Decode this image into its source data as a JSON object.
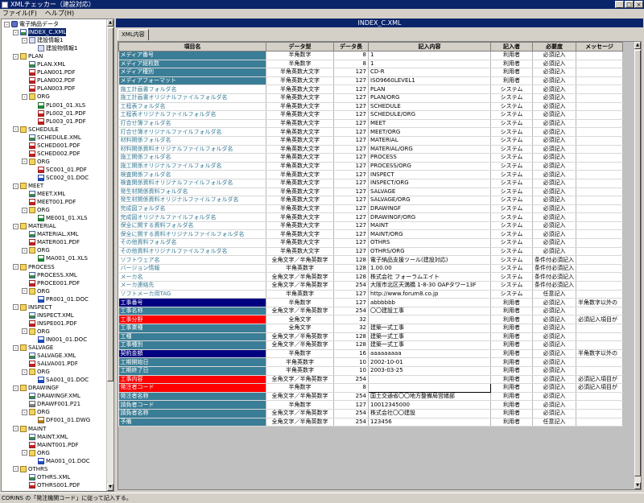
{
  "window": {
    "title": "XMLチェッカー（建設対応）",
    "buttons": [
      "_",
      "□",
      "×"
    ]
  },
  "menu": [
    {
      "label": "ファイル(F)"
    },
    {
      "label": "ヘルプ(H)"
    }
  ],
  "tree": {
    "items": [
      {
        "label": "電子納品データ",
        "level": 0,
        "icon": "db",
        "box": "-"
      },
      {
        "label": "INDEX_C.XML",
        "level": 1,
        "icon": "xml",
        "box": "-",
        "selected": true
      },
      {
        "label": "建設情報1",
        "level": 2,
        "icon": "node",
        "box": "-"
      },
      {
        "label": "建設物情報1",
        "level": 3,
        "icon": "node",
        "box": ""
      },
      {
        "label": "PLAN",
        "level": 1,
        "icon": "folder",
        "box": "-"
      },
      {
        "label": "PLAN.XML",
        "level": 2,
        "icon": "xml",
        "box": ""
      },
      {
        "label": "PLAN001.PDF",
        "level": 2,
        "icon": "pdf",
        "box": ""
      },
      {
        "label": "PLAN002.PDF",
        "level": 2,
        "icon": "pdf",
        "box": ""
      },
      {
        "label": "PLAN003.PDF",
        "level": 2,
        "icon": "pdf",
        "box": ""
      },
      {
        "label": "ORG",
        "level": 2,
        "icon": "folder",
        "box": "-"
      },
      {
        "label": "PL001_01.XLS",
        "level": 3,
        "icon": "xls",
        "box": ""
      },
      {
        "label": "PL002_01.PDF",
        "level": 3,
        "icon": "pdf",
        "box": ""
      },
      {
        "label": "PL003_01.PDF",
        "level": 3,
        "icon": "pdf",
        "box": ""
      },
      {
        "label": "SCHEDULE",
        "level": 1,
        "icon": "folder",
        "box": "-"
      },
      {
        "label": "SCHEDULE.XML",
        "level": 2,
        "icon": "xml",
        "box": ""
      },
      {
        "label": "SCHED001.PDF",
        "level": 2,
        "icon": "pdf",
        "box": ""
      },
      {
        "label": "SCHED002.PDF",
        "level": 2,
        "icon": "pdf",
        "box": ""
      },
      {
        "label": "ORG",
        "level": 2,
        "icon": "folder",
        "box": "-"
      },
      {
        "label": "SC001_01.PDF",
        "level": 3,
        "icon": "pdf",
        "box": ""
      },
      {
        "label": "SC002_01.DOC",
        "level": 3,
        "icon": "doc",
        "box": ""
      },
      {
        "label": "MEET",
        "level": 1,
        "icon": "folder",
        "box": "-"
      },
      {
        "label": "MEET.XML",
        "level": 2,
        "icon": "xml",
        "box": ""
      },
      {
        "label": "MEET001.PDF",
        "level": 2,
        "icon": "pdf",
        "box": ""
      },
      {
        "label": "ORG",
        "level": 2,
        "icon": "folder",
        "box": "-"
      },
      {
        "label": "ME001_01.XLS",
        "level": 3,
        "icon": "xls",
        "box": ""
      },
      {
        "label": "MATERIAL",
        "level": 1,
        "icon": "folder",
        "box": "-"
      },
      {
        "label": "MATERIAL.XML",
        "level": 2,
        "icon": "xml",
        "box": ""
      },
      {
        "label": "MATER001.PDF",
        "level": 2,
        "icon": "pdf",
        "box": ""
      },
      {
        "label": "ORG",
        "level": 2,
        "icon": "folder",
        "box": "-"
      },
      {
        "label": "MA001_01.XLS",
        "level": 3,
        "icon": "xls",
        "box": ""
      },
      {
        "label": "PROCESS",
        "level": 1,
        "icon": "folder",
        "box": "-"
      },
      {
        "label": "PROCESS.XML",
        "level": 2,
        "icon": "xml",
        "box": ""
      },
      {
        "label": "PROCE001.PDF",
        "level": 2,
        "icon": "pdf",
        "box": ""
      },
      {
        "label": "ORG",
        "level": 2,
        "icon": "folder",
        "box": "-"
      },
      {
        "label": "PR001_01.DOC",
        "level": 3,
        "icon": "doc",
        "box": ""
      },
      {
        "label": "INSPECT",
        "level": 1,
        "icon": "folder",
        "box": "-"
      },
      {
        "label": "INSPECT.XML",
        "level": 2,
        "icon": "xml",
        "box": ""
      },
      {
        "label": "INSPE001.PDF",
        "level": 2,
        "icon": "pdf",
        "box": ""
      },
      {
        "label": "ORG",
        "level": 2,
        "icon": "folder",
        "box": "-"
      },
      {
        "label": "IN001_01.DOC",
        "level": 3,
        "icon": "doc",
        "box": ""
      },
      {
        "label": "SALVAGE",
        "level": 1,
        "icon": "folder",
        "box": "-"
      },
      {
        "label": "SALVAGE.XML",
        "level": 2,
        "icon": "xml",
        "box": ""
      },
      {
        "label": "SALVA001.PDF",
        "level": 2,
        "icon": "pdf",
        "box": ""
      },
      {
        "label": "ORG",
        "level": 2,
        "icon": "folder",
        "box": "-"
      },
      {
        "label": "SA001_01.DOC",
        "level": 3,
        "icon": "doc",
        "box": ""
      },
      {
        "label": "DRAWINGF",
        "level": 1,
        "icon": "folder",
        "box": "-"
      },
      {
        "label": "DRAWINGF.XML",
        "level": 2,
        "icon": "xml",
        "box": ""
      },
      {
        "label": "DRAWF001.P21",
        "level": 2,
        "icon": "p21",
        "box": ""
      },
      {
        "label": "ORG",
        "level": 2,
        "icon": "folder",
        "box": "-"
      },
      {
        "label": "DF001_01.DWG",
        "level": 3,
        "icon": "dwg",
        "box": ""
      },
      {
        "label": "MAINT",
        "level": 1,
        "icon": "folder",
        "box": "-"
      },
      {
        "label": "MAINT.XML",
        "level": 2,
        "icon": "xml",
        "box": ""
      },
      {
        "label": "MAINT001.PDF",
        "level": 2,
        "icon": "pdf",
        "box": ""
      },
      {
        "label": "ORG",
        "level": 2,
        "icon": "folder",
        "box": "-"
      },
      {
        "label": "MA001_01.DOC",
        "level": 3,
        "icon": "doc",
        "box": ""
      },
      {
        "label": "OTHRS",
        "level": 1,
        "icon": "folder",
        "box": "-"
      },
      {
        "label": "OTHRS.XML",
        "level": 2,
        "icon": "xml",
        "box": ""
      },
      {
        "label": "OTHRS001.PDF",
        "level": 2,
        "icon": "pdf",
        "box": ""
      }
    ]
  },
  "header": {
    "title": "INDEX_C.XML"
  },
  "tab": {
    "label": "XML内容"
  },
  "grid": {
    "columns": [
      "項目名",
      "データ型",
      "データ長",
      "記入内容",
      "記入者",
      "必要度",
      "メッセージ"
    ],
    "styles": {
      "teal": {
        "bg": "#3a7d96",
        "fg": "#ffffff"
      },
      "link": {
        "bg": "#ffffff",
        "fg": "#3a7d96"
      },
      "navy": {
        "bg": "#000080",
        "fg": "#ffffff"
      },
      "red": {
        "bg": "#ff0000",
        "fg": "#ffffff"
      }
    },
    "rows": [
      [
        "メディア番号",
        "半角数字",
        "8",
        "1",
        "利用者",
        "必須記入",
        "",
        "teal"
      ],
      [
        "メディア総枚数",
        "半角数字",
        "8",
        "1",
        "利用者",
        "必須記入",
        "",
        "teal"
      ],
      [
        "メディア種別",
        "半角英数大文字",
        "127",
        "CD-R",
        "利用者",
        "必須記入",
        "",
        "teal"
      ],
      [
        "メディアフォーマット",
        "半角英数大文字",
        "127",
        "ISO9660LEVEL1",
        "利用者",
        "必須記入",
        "",
        "teal"
      ],
      [
        "施工計画書フォルダ名",
        "半角英数大文字",
        "127",
        "PLAN",
        "システム",
        "必須記入",
        "",
        "link"
      ],
      [
        "施工計画書オリジナルファイルフォルダ名",
        "半角英数大文字",
        "127",
        "PLAN/ORG",
        "システム",
        "必須記入",
        "",
        "link"
      ],
      [
        "工程表フォルダ名",
        "半角英数大文字",
        "127",
        "SCHEDULE",
        "システム",
        "必須記入",
        "",
        "link"
      ],
      [
        "工程表オリジナルファイルフォルダ名",
        "半角英数大文字",
        "127",
        "SCHEDULE/ORG",
        "システム",
        "必須記入",
        "",
        "link"
      ],
      [
        "打合せ簿フォルダ名",
        "半角英数大文字",
        "127",
        "MEET",
        "システム",
        "必須記入",
        "",
        "link"
      ],
      [
        "打合せ簿オリジナルファイルフォルダ名",
        "半角英数大文字",
        "127",
        "MEET/ORG",
        "システム",
        "必須記入",
        "",
        "link"
      ],
      [
        "材料関係フォルダ名",
        "半角英数大文字",
        "127",
        "MATERIAL",
        "システム",
        "必須記入",
        "",
        "link"
      ],
      [
        "材料関係資料オリジナルファイルフォルダ名",
        "半角英数大文字",
        "127",
        "MATERIAL/ORG",
        "システム",
        "必須記入",
        "",
        "link"
      ],
      [
        "施工関係フォルダ名",
        "半角英数大文字",
        "127",
        "PROCESS",
        "システム",
        "必須記入",
        "",
        "link"
      ],
      [
        "施工関係オリジナルファイルフォルダ名",
        "半角英数大文字",
        "127",
        "PROCESS/ORG",
        "システム",
        "必須記入",
        "",
        "link"
      ],
      [
        "検査関係フォルダ名",
        "半角英数大文字",
        "127",
        "INSPECT",
        "システム",
        "必須記入",
        "",
        "link"
      ],
      [
        "検査関係資料オリジナルファイルフォルダ名",
        "半角英数大文字",
        "127",
        "INSPECT/ORG",
        "システム",
        "必須記入",
        "",
        "link"
      ],
      [
        "発生材関係資料フォルダ名",
        "半角英数大文字",
        "127",
        "SALVAGE",
        "システム",
        "必須記入",
        "",
        "link"
      ],
      [
        "発生材関係資料オリジナルファイルフォルダ名",
        "半角英数大文字",
        "127",
        "SALVAGE/ORG",
        "システム",
        "必須記入",
        "",
        "link"
      ],
      [
        "完成図フォルダ名",
        "半角英数大文字",
        "127",
        "DRAWINGF",
        "システム",
        "必須記入",
        "",
        "link"
      ],
      [
        "完成図オリジナルファイルフォルダ名",
        "半角英数大文字",
        "127",
        "DRAWINGF/ORG",
        "システム",
        "必須記入",
        "",
        "link"
      ],
      [
        "保全に関する資料フォルダ名",
        "半角英数大文字",
        "127",
        "MAINT",
        "システム",
        "必須記入",
        "",
        "link"
      ],
      [
        "保全に関する資料オリジナルファイルフォルダ名",
        "半角英数大文字",
        "127",
        "MAINT/ORG",
        "システム",
        "必須記入",
        "",
        "link"
      ],
      [
        "その他資料フォルダ名",
        "半角英数大文字",
        "127",
        "OTHRS",
        "システム",
        "必須記入",
        "",
        "link"
      ],
      [
        "その他資料オリジナルファイルフォルダ名",
        "半角英数大文字",
        "127",
        "OTHRS/ORG",
        "システム",
        "必須記入",
        "",
        "link"
      ],
      [
        "ソフトウェア名",
        "全角文字／半角英数字",
        "128",
        "電子納品支援ツール(建設対応)",
        "システム",
        "条件付必須記入",
        "",
        "link"
      ],
      [
        "バージョン情報",
        "半角英数字",
        "128",
        "1.00.00",
        "システム",
        "条件付必須記入",
        "",
        "link"
      ],
      [
        "メーカ名",
        "全角文字／半角英数字",
        "128",
        "株式会社 フォーラムエイト",
        "システム",
        "条件付必須記入",
        "",
        "link"
      ],
      [
        "メーカ連絡先",
        "全角文字／半角英数字",
        "254",
        "大阪市北区天満橋 1-8-30 OAPタワー13F",
        "システム",
        "条件付必須記入",
        "",
        "link"
      ],
      [
        "ソフトメーカ用TAG",
        "半角英数字",
        "127",
        "http://www.forum8.co.jp",
        "システム",
        "任意記入",
        "",
        "link"
      ],
      [
        "工事番号",
        "半角数字",
        "127",
        "abbbbbb",
        "利用者",
        "必須記入",
        "半角数字以外の",
        "navy"
      ],
      [
        "工事名称",
        "全角文字／半角英数字",
        "254",
        "〇〇建設工事",
        "利用者",
        "必須記入",
        "",
        "teal"
      ],
      [
        "工事分野",
        "全角文字",
        "32",
        "",
        "利用者",
        "必須記入",
        "必須記入項目が",
        "red"
      ],
      [
        "工事業種",
        "全角文字",
        "32",
        "建築一式工事",
        "利用者",
        "必須記入",
        "",
        "teal"
      ],
      [
        "工種",
        "全角文字／半角英数字",
        "128",
        "建築一式工事",
        "利用者",
        "必須記入",
        "",
        "teal"
      ],
      [
        "工事種別",
        "全角文字／半角英数字",
        "128",
        "建築一式工事",
        "利用者",
        "必須記入",
        "",
        "teal"
      ],
      [
        "契約金額",
        "半角数字",
        "16",
        "aaaaaaaaa",
        "利用者",
        "必須記入",
        "半角数字以外の",
        "navy"
      ],
      [
        "工期開始日",
        "半角英数字",
        "10",
        "2002-10-01",
        "利用者",
        "必須記入",
        "",
        "teal"
      ],
      [
        "工期終了日",
        "半角英数字",
        "10",
        "2003-03-25",
        "利用者",
        "必須記入",
        "",
        "teal"
      ],
      [
        "工事内容",
        "全角文字／半角英数字",
        "254",
        "",
        "利用者",
        "必須記入",
        "必須記入項目が",
        "red"
      ],
      [
        "発注者コード",
        "半角数字",
        "8",
        "",
        "利用者",
        "必須記入",
        "必須記入項目が",
        "red"
      ],
      [
        "発注者名称",
        "全角文字／半角英数字",
        "254",
        "国土交通省〇〇地方整備局営繕部",
        "利用者",
        "必須記入",
        "",
        "teal"
      ],
      [
        "請負者コード",
        "半角数字",
        "127",
        "10012345000",
        "利用者",
        "必須記入",
        "",
        "teal"
      ],
      [
        "請負者名称",
        "全角文字／半角英数字",
        "254",
        "株式会社〇〇建設",
        "利用者",
        "必須記入",
        "",
        "teal"
      ],
      [
        "予備",
        "全角文字／半角英数字",
        "254",
        "123456",
        "利用者",
        "任意記入",
        "",
        "teal"
      ]
    ]
  },
  "status": {
    "text": "CORINS の「発注機関コード」に従って記入する。"
  }
}
